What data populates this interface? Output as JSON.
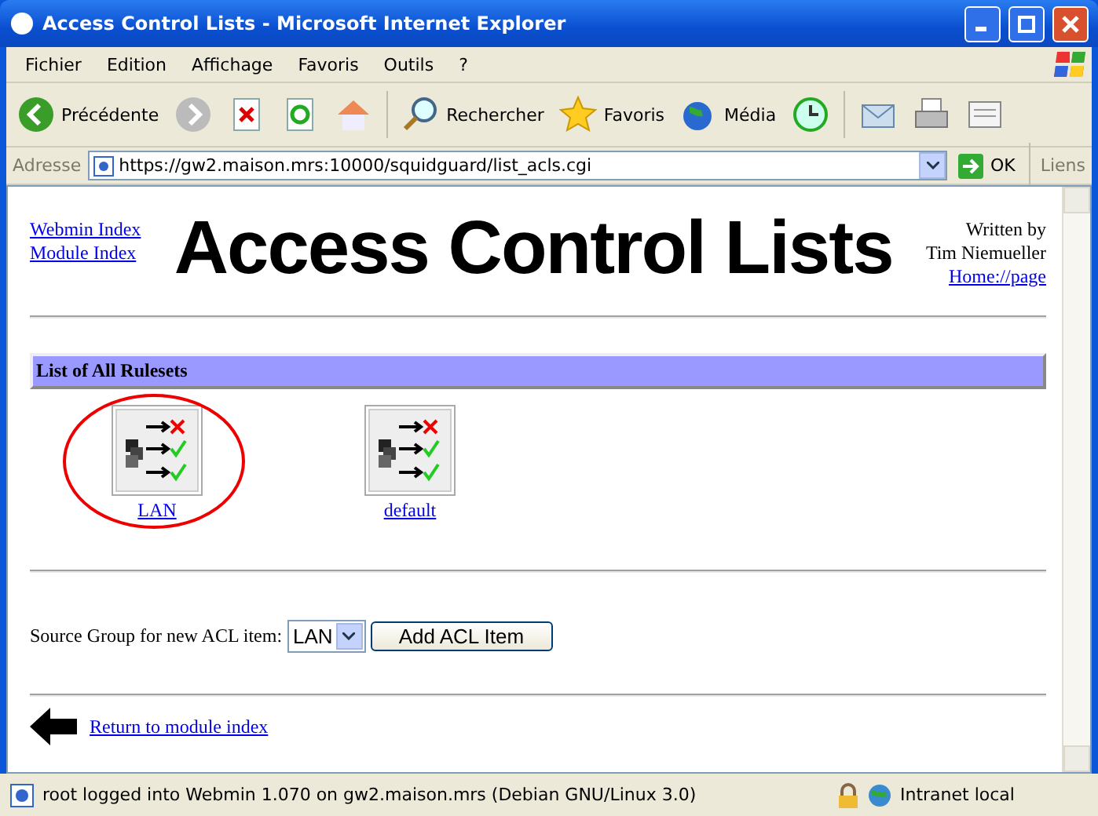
{
  "window": {
    "title": "Access Control Lists - Microsoft Internet Explorer"
  },
  "menu": [
    "Fichier",
    "Edition",
    "Affichage",
    "Favoris",
    "Outils",
    "?"
  ],
  "toolbar": [
    {
      "kind": "back",
      "label": "Précédente"
    },
    {
      "kind": "forward"
    },
    {
      "kind": "stop"
    },
    {
      "kind": "refresh"
    },
    {
      "kind": "home"
    },
    {
      "kind": "search",
      "label": "Rechercher"
    },
    {
      "kind": "favorites",
      "label": "Favoris"
    },
    {
      "kind": "media",
      "label": "Média"
    },
    {
      "kind": "history"
    },
    {
      "kind": "mail"
    },
    {
      "kind": "print"
    },
    {
      "kind": "edit"
    }
  ],
  "address": {
    "label": "Adresse",
    "value": "https://gw2.maison.mrs:10000/squidguard/list_acls.cgi",
    "go": "OK",
    "links": "Liens"
  },
  "page": {
    "nav_links": [
      "Webmin Index",
      "Module Index"
    ],
    "heading": "Access Control Lists",
    "credit": "Written by",
    "author": "Tim Niemueller",
    "home_link": "Home://page",
    "section_title": "List of All Rulesets",
    "rulesets": [
      {
        "name": "LAN",
        "circled": true
      },
      {
        "name": "default",
        "circled": false
      }
    ],
    "form_label": "Source Group for new ACL item:",
    "group_select": "LAN",
    "add_button": "Add ACL Item",
    "return_link": "Return to module index"
  },
  "status_bar": {
    "text": "root logged into Webmin 1.070 on gw2.maison.mrs (Debian GNU/Linux 3.0)",
    "zone": "Intranet local"
  }
}
